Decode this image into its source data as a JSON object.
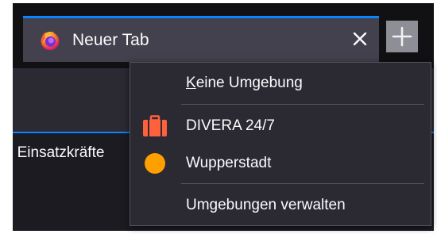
{
  "tab": {
    "title": "Neuer Tab",
    "favicon": "firefox-logo-icon",
    "close_icon": "close-icon"
  },
  "newtab": {
    "icon": "plus-icon"
  },
  "bookmarks": {
    "item_label": "r Einsatzkräfte"
  },
  "container_menu": {
    "no_container": {
      "accel": "K",
      "rest": "eine Umgebung"
    },
    "items": [
      {
        "label": "DIVERA 24/7",
        "icon": "briefcase-icon",
        "color": "#ff613d"
      },
      {
        "label": "Wupperstadt",
        "icon": "circle-icon",
        "color": "#ff9f00"
      }
    ],
    "manage_label": "Umgebungen verwalten"
  },
  "colors": {
    "accent": "#0a84ff",
    "tab_bg": "#42414d",
    "menu_bg": "#2b2a33"
  }
}
